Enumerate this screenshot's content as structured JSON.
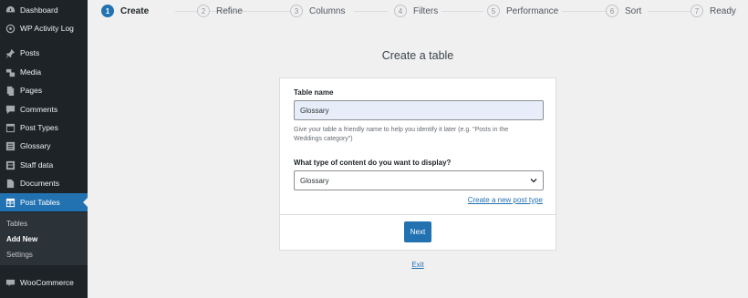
{
  "sidebar": {
    "items": [
      {
        "label": "Dashboard",
        "icon": "dashboard-icon"
      },
      {
        "label": "WP Activity Log",
        "icon": "activity-log-icon"
      },
      {
        "label": "Posts",
        "icon": "pin-icon"
      },
      {
        "label": "Media",
        "icon": "media-icon"
      },
      {
        "label": "Pages",
        "icon": "pages-icon"
      },
      {
        "label": "Comments",
        "icon": "comment-icon"
      },
      {
        "label": "Post Types",
        "icon": "post-types-icon"
      },
      {
        "label": "Glossary",
        "icon": "glossary-icon"
      },
      {
        "label": "Staff data",
        "icon": "staff-icon"
      },
      {
        "label": "Documents",
        "icon": "documents-icon"
      },
      {
        "label": "Post Tables",
        "icon": "table-icon"
      },
      {
        "label": "WooCommerce",
        "icon": "woocommerce-icon"
      }
    ],
    "submenu": [
      "Tables",
      "Add New",
      "Settings"
    ],
    "active_color": "#2271b1"
  },
  "steps": [
    {
      "num": "1",
      "label": "Create"
    },
    {
      "num": "2",
      "label": "Refine"
    },
    {
      "num": "3",
      "label": "Columns"
    },
    {
      "num": "4",
      "label": "Filters"
    },
    {
      "num": "5",
      "label": "Performance"
    },
    {
      "num": "6",
      "label": "Sort"
    },
    {
      "num": "7",
      "label": "Ready"
    }
  ],
  "main": {
    "title": "Create a table",
    "name_label": "Table name",
    "name_value": "Glossary",
    "help": "Give your table a friendly name to help you identify it later (e.g. \"Posts in the Weddings category\")",
    "type_label": "What type of content do you want to display?",
    "type_value": "Glossary",
    "create_link": "Create a new post type",
    "next_label": "Next",
    "exit_label": "Exit"
  }
}
